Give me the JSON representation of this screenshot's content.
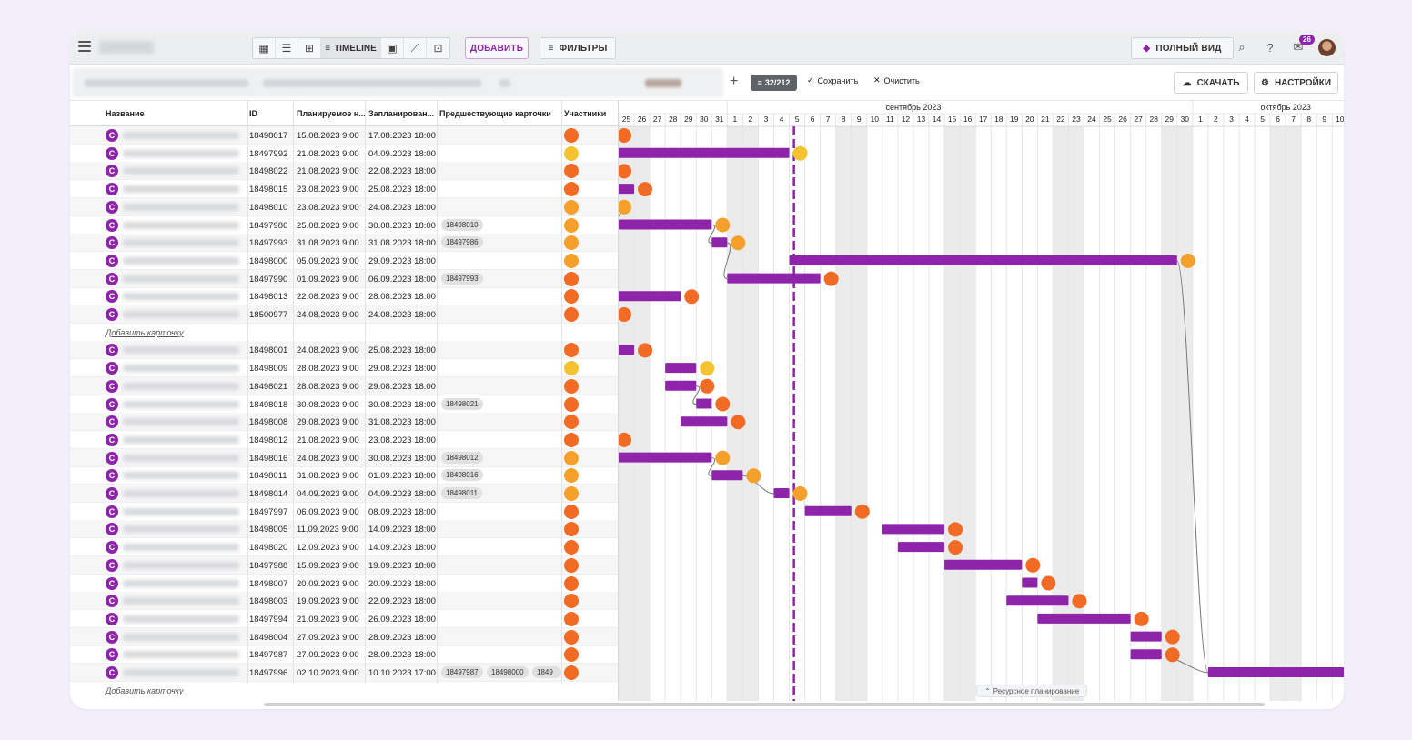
{
  "toolbar": {
    "view_timeline_label": "TIMELINE",
    "add_label": "ДОБАВИТЬ",
    "filters_label": "ФИЛЬТРЫ",
    "full_view_label": "ПОЛНЫЙ ВИД",
    "notifications_count": "26"
  },
  "subbar": {
    "filter_count": "32/212",
    "save_label": "Сохранить",
    "clear_label": "Очистить",
    "download_label": "СКАЧАТЬ",
    "settings_label": "НАСТРОЙКИ"
  },
  "table": {
    "headers": {
      "name": "Название",
      "id": "ID",
      "planned": "Планируемое н...",
      "scheduled": "Запланирован...",
      "predecessors": "Предшествующие карточки",
      "participants": "Участники"
    },
    "add_card_label": "Добавить карточку",
    "avatar_letter": "C",
    "group1": [
      {
        "id": "18498017",
        "start": "15.08.2023 9:00",
        "end": "17.08.2023 18:00",
        "pred": [],
        "dot": "#f26b25"
      },
      {
        "id": "18497992",
        "start": "21.08.2023 9:00",
        "end": "04.09.2023 18:00",
        "pred": [],
        "dot": "#f5c330"
      },
      {
        "id": "18498022",
        "start": "21.08.2023 9:00",
        "end": "22.08.2023 18:00",
        "pred": [],
        "dot": "#f26b25"
      },
      {
        "id": "18498015",
        "start": "23.08.2023 9:00",
        "end": "25.08.2023 18:00",
        "pred": [],
        "dot": "#f26b25"
      },
      {
        "id": "18498010",
        "start": "23.08.2023 9:00",
        "end": "24.08.2023 18:00",
        "pred": [],
        "dot": "#f5a02a"
      },
      {
        "id": "18497986",
        "start": "25.08.2023 9:00",
        "end": "30.08.2023 18:00",
        "pred": [
          "18498010"
        ],
        "dot": "#f5a02a"
      },
      {
        "id": "18497993",
        "start": "31.08.2023 9:00",
        "end": "31.08.2023 18:00",
        "pred": [
          "18497986"
        ],
        "dot": "#f5a02a"
      },
      {
        "id": "18498000",
        "start": "05.09.2023 9:00",
        "end": "29.09.2023 18:00",
        "pred": [],
        "dot": "#f5a02a"
      },
      {
        "id": "18497990",
        "start": "01.09.2023 9:00",
        "end": "06.09.2023 18:00",
        "pred": [
          "18497993"
        ],
        "dot": "#f26b25"
      },
      {
        "id": "18498013",
        "start": "22.08.2023 9:00",
        "end": "28.08.2023 18:00",
        "pred": [],
        "dot": "#f26b25"
      },
      {
        "id": "18500977",
        "start": "24.08.2023 9:00",
        "end": "24.08.2023 18:00",
        "pred": [],
        "dot": "#f26b25"
      }
    ],
    "group2": [
      {
        "id": "18498001",
        "start": "24.08.2023 9:00",
        "end": "25.08.2023 18:00",
        "pred": [],
        "dot": "#f26b25"
      },
      {
        "id": "18498009",
        "start": "28.08.2023 9:00",
        "end": "29.08.2023 18:00",
        "pred": [],
        "dot": "#f5c330"
      },
      {
        "id": "18498021",
        "start": "28.08.2023 9:00",
        "end": "29.08.2023 18:00",
        "pred": [],
        "dot": "#f26b25"
      },
      {
        "id": "18498018",
        "start": "30.08.2023 9:00",
        "end": "30.08.2023 18:00",
        "pred": [
          "18498021"
        ],
        "dot": "#f26b25"
      },
      {
        "id": "18498008",
        "start": "29.08.2023 9:00",
        "end": "31.08.2023 18:00",
        "pred": [],
        "dot": "#f26b25"
      },
      {
        "id": "18498012",
        "start": "21.08.2023 9:00",
        "end": "23.08.2023 18:00",
        "pred": [],
        "dot": "#f26b25"
      },
      {
        "id": "18498016",
        "start": "24.08.2023 9:00",
        "end": "30.08.2023 18:00",
        "pred": [
          "18498012"
        ],
        "dot": "#f5a02a"
      },
      {
        "id": "18498011",
        "start": "31.08.2023 9:00",
        "end": "01.09.2023 18:00",
        "pred": [
          "18498016"
        ],
        "dot": "#f5a02a"
      },
      {
        "id": "18498014",
        "start": "04.09.2023 9:00",
        "end": "04.09.2023 18:00",
        "pred": [
          "18498011"
        ],
        "dot": "#f5a02a"
      },
      {
        "id": "18497997",
        "start": "06.09.2023 9:00",
        "end": "08.09.2023 18:00",
        "pred": [],
        "dot": "#f26b25"
      },
      {
        "id": "18498005",
        "start": "11.09.2023 9:00",
        "end": "14.09.2023 18:00",
        "pred": [],
        "dot": "#f26b25"
      },
      {
        "id": "18498020",
        "start": "12.09.2023 9:00",
        "end": "14.09.2023 18:00",
        "pred": [],
        "dot": "#f26b25"
      },
      {
        "id": "18497988",
        "start": "15.09.2023 9:00",
        "end": "19.09.2023 18:00",
        "pred": [],
        "dot": "#f26b25"
      },
      {
        "id": "18498007",
        "start": "20.09.2023 9:00",
        "end": "20.09.2023 18:00",
        "pred": [],
        "dot": "#f26b25"
      },
      {
        "id": "18498003",
        "start": "19.09.2023 9:00",
        "end": "22.09.2023 18:00",
        "pred": [],
        "dot": "#f26b25"
      },
      {
        "id": "18497994",
        "start": "21.09.2023 9:00",
        "end": "26.09.2023 18:00",
        "pred": [],
        "dot": "#f26b25"
      },
      {
        "id": "18498004",
        "start": "27.09.2023 9:00",
        "end": "28.09.2023 18:00",
        "pred": [],
        "dot": "#f26b25"
      },
      {
        "id": "18497987",
        "start": "27.09.2023 9:00",
        "end": "28.09.2023 18:00",
        "pred": [],
        "dot": "#f26b25"
      },
      {
        "id": "18497996",
        "start": "02.10.2023 9:00",
        "end": "10.10.2023 17:00",
        "pred": [
          "18497987",
          "18498000",
          "1849"
        ],
        "dot": "#f26b25"
      }
    ]
  },
  "timeline": {
    "month_sep": "сентябрь 2023",
    "month_oct": "октябрь 2023",
    "days": [
      "25",
      "26",
      "27",
      "28",
      "29",
      "30",
      "31",
      "1",
      "2",
      "3",
      "4",
      "5",
      "6",
      "7",
      "8",
      "9",
      "10",
      "11",
      "12",
      "13",
      "14",
      "15",
      "16",
      "17",
      "18",
      "19",
      "20",
      "21",
      "22",
      "23",
      "24",
      "25",
      "26",
      "27",
      "28",
      "29",
      "30",
      "1",
      "2",
      "3",
      "4",
      "5",
      "6",
      "7",
      "8",
      "9",
      "10"
    ],
    "resource_label": "Ресурсное планирование"
  },
  "colors": {
    "accent": "#8e24aa",
    "bar": "#8e24aa",
    "orange": "#f26b25",
    "amber": "#f5a02a",
    "yellow": "#f5c330"
  }
}
